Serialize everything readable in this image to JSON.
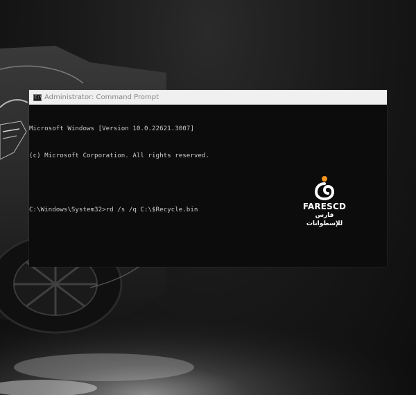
{
  "window": {
    "title": "Administrator: Command Prompt",
    "icon": "cmd-icon",
    "icon_glyph": "C:\\"
  },
  "console": {
    "lines": [
      "Microsoft Windows [Version 10.0.22621.3007]",
      "(c) Microsoft Corporation. All rights reserved.",
      "",
      "C:\\Windows\\System32>rd /s /q C:\\$Recycle.bin"
    ]
  },
  "watermark": {
    "name": "FARESCD",
    "subtitle": "فارس للإسطوانات",
    "accent": "#f7941d"
  },
  "colors": {
    "console_background": "#0c0c0c",
    "console_text": "#cccccc",
    "titlebar": "#f0f0f0"
  }
}
